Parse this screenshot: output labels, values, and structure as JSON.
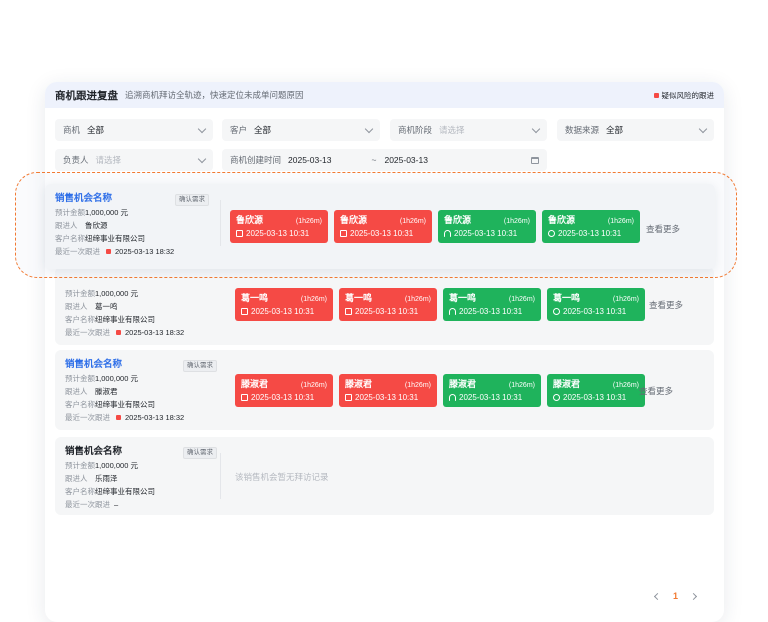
{
  "header": {
    "title": "商机跟进复盘",
    "subtitle": "追溯商机拜访全轨迹，快速定位未成单问题原因",
    "legend": "疑似风险的跟进",
    "risk_color": "#f54a45"
  },
  "filters": {
    "opportunity": {
      "label": "商机",
      "value": "全部"
    },
    "customer": {
      "label": "客户",
      "value": "全部"
    },
    "stage": {
      "label": "商机阶段",
      "placeholder": "请选择"
    },
    "source": {
      "label": "数据来源",
      "value": "全部"
    },
    "owner": {
      "label": "负责人",
      "placeholder": "请选择"
    },
    "created": {
      "label": "商机创建时间",
      "start": "2025-03-13",
      "sep": "~",
      "end": "2025-03-13"
    }
  },
  "labels": {
    "amount": "预计金额",
    "follower": "跟进人",
    "customer": "客户名称",
    "last": "最近一次跟进",
    "more": "查看更多",
    "empty": "该销售机会暂无拜访记录"
  },
  "colors": {
    "alert_red": "#f54a45",
    "ok_green": "#1fb35c",
    "link_blue": "#2f6fe8",
    "highlight_orange": "#f27a32"
  },
  "cards": [
    {
      "name": "销售机会名称",
      "tag": "确认需求",
      "amount": "1,000,000 元",
      "follower": "鲁欣源",
      "customer": "纽缔事业有限公司",
      "last": "2025-03-13 18:32",
      "chips": [
        {
          "name": "鲁欣源",
          "dur": "(1h26m)",
          "date": "2025-03-13 10:31",
          "color": "red",
          "icon": "document-icon"
        },
        {
          "name": "鲁欣源",
          "dur": "(1h26m)",
          "date": "2025-03-13 10:31",
          "color": "red",
          "icon": "document-icon"
        },
        {
          "name": "鲁欣源",
          "dur": "(1h26m)",
          "date": "2025-03-13 10:31",
          "color": "green",
          "icon": "headset-icon"
        },
        {
          "name": "鲁欣源",
          "dur": "(1h26m)",
          "date": "2025-03-13 10:31",
          "color": "green",
          "icon": "refresh-icon"
        }
      ]
    },
    {
      "name": "",
      "tag": "",
      "amount": "1,000,000 元",
      "follower": "葛一鸣",
      "customer": "纽缔事业有限公司",
      "last": "2025-03-13 18:32",
      "chips": [
        {
          "name": "葛一鸣",
          "dur": "(1h26m)",
          "date": "2025-03-13 10:31",
          "color": "red",
          "icon": "document-icon"
        },
        {
          "name": "葛一鸣",
          "dur": "(1h26m)",
          "date": "2025-03-13 10:31",
          "color": "red",
          "icon": "document-icon"
        },
        {
          "name": "葛一鸣",
          "dur": "(1h26m)",
          "date": "2025-03-13 10:31",
          "color": "green",
          "icon": "headset-icon"
        },
        {
          "name": "葛一鸣",
          "dur": "(1h26m)",
          "date": "2025-03-13 10:31",
          "color": "green",
          "icon": "refresh-icon"
        }
      ]
    },
    {
      "name": "销售机会名称",
      "tag": "确认需求",
      "amount": "1,000,000 元",
      "follower": "滕淑君",
      "customer": "纽缔事业有限公司",
      "last": "2025-03-13 18:32",
      "chips": [
        {
          "name": "滕淑君",
          "dur": "(1h26m)",
          "date": "2025-03-13 10:31",
          "color": "red",
          "icon": "document-icon"
        },
        {
          "name": "滕淑君",
          "dur": "(1h26m)",
          "date": "2025-03-13 10:31",
          "color": "red",
          "icon": "document-icon"
        },
        {
          "name": "滕淑君",
          "dur": "(1h26m)",
          "date": "2025-03-13 10:31",
          "color": "green",
          "icon": "headset-icon"
        },
        {
          "name": "滕淑君",
          "dur": "(1h26m)",
          "date": "2025-03-13 10:31",
          "color": "green",
          "icon": "refresh-icon"
        }
      ]
    },
    {
      "name": "销售机会名称",
      "tag": "确认需求",
      "amount": "1,000,000 元",
      "follower": "乐雨泽",
      "customer": "纽缔事业有限公司",
      "last": "–",
      "chips": []
    }
  ],
  "pager": {
    "current": "1"
  }
}
